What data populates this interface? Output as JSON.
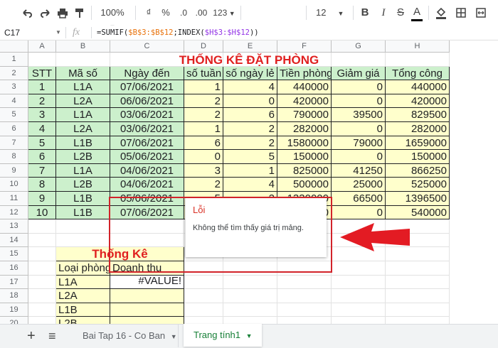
{
  "toolbar": {
    "zoom": "100%",
    "currency": "₫",
    "percent": "%",
    "dec_decrease": ".0",
    "dec_increase": ".00",
    "more_formats": "123",
    "font_size": "12",
    "bold": "B",
    "italic": "I",
    "strike": "S",
    "text_color": "A"
  },
  "formula_bar": {
    "cell_ref": "C17",
    "fx": "fx",
    "formula_prefix": "=SUMIF(",
    "formula_ref1": "$B$3:$B$12",
    "formula_mid": ";INDEX(",
    "formula_ref2": "$H$3:$H$12",
    "formula_suffix": "))"
  },
  "columns": [
    "A",
    "B",
    "C",
    "D",
    "E",
    "F",
    "G",
    "H"
  ],
  "rows": [
    "1",
    "2",
    "3",
    "4",
    "5",
    "6",
    "7",
    "8",
    "9",
    "10",
    "11",
    "12",
    "13",
    "14",
    "15",
    "16",
    "17",
    "18",
    "19",
    "20"
  ],
  "sheet": {
    "title": "THỐNG KÊ ĐẶT PHÒNG",
    "headers": [
      "STT",
      "Mã số",
      "Ngày đến",
      "số tuần",
      "số ngày lẻ",
      "Tiền phòng",
      "Giảm giá",
      "Tổng công"
    ],
    "data": [
      [
        "1",
        "L1A",
        "07/06/2021",
        "1",
        "4",
        "440000",
        "0",
        "440000"
      ],
      [
        "2",
        "L2A",
        "06/06/2021",
        "2",
        "0",
        "420000",
        "0",
        "420000"
      ],
      [
        "3",
        "L1A",
        "03/06/2021",
        "2",
        "6",
        "790000",
        "39500",
        "829500"
      ],
      [
        "4",
        "L2A",
        "03/06/2021",
        "1",
        "2",
        "282000",
        "0",
        "282000"
      ],
      [
        "5",
        "L1B",
        "07/06/2021",
        "6",
        "2",
        "1580000",
        "79000",
        "1659000"
      ],
      [
        "6",
        "L2B",
        "05/06/2021",
        "0",
        "5",
        "150000",
        "0",
        "150000"
      ],
      [
        "7",
        "L1A",
        "04/06/2021",
        "3",
        "1",
        "825000",
        "41250",
        "866250"
      ],
      [
        "8",
        "L2B",
        "04/06/2021",
        "2",
        "4",
        "500000",
        "25000",
        "525000"
      ],
      [
        "9",
        "L1B",
        "05/06/2021",
        "5",
        "2",
        "1330000",
        "66500",
        "1396500"
      ],
      [
        "10",
        "L1B",
        "07/06/2021",
        "",
        "",
        "0",
        "0",
        "540000"
      ]
    ],
    "stats_title": "Thống Kê",
    "stats_headers": [
      "Loại phòng",
      "Doanh thu"
    ],
    "stats_rows": [
      [
        "L1A",
        "#VALUE!"
      ],
      [
        "L2A",
        ""
      ],
      [
        "L1B",
        ""
      ],
      [
        "L2B",
        ""
      ]
    ]
  },
  "error_popup": {
    "title": "Lỗi",
    "message": "Không thể tìm thấy giá trị mảng."
  },
  "tabs": {
    "add": "+",
    "list": "≡",
    "items": [
      "Bai Tap 16 - Co Ban",
      "Trang tính1"
    ],
    "active": "Trang tính1"
  },
  "colors": {
    "title_red": "#e02020",
    "header_green": "#ccf0cc",
    "body_yellow": "#ffffcc",
    "formula_orange": "#e8710a",
    "annotation_red": "#e31b23"
  }
}
